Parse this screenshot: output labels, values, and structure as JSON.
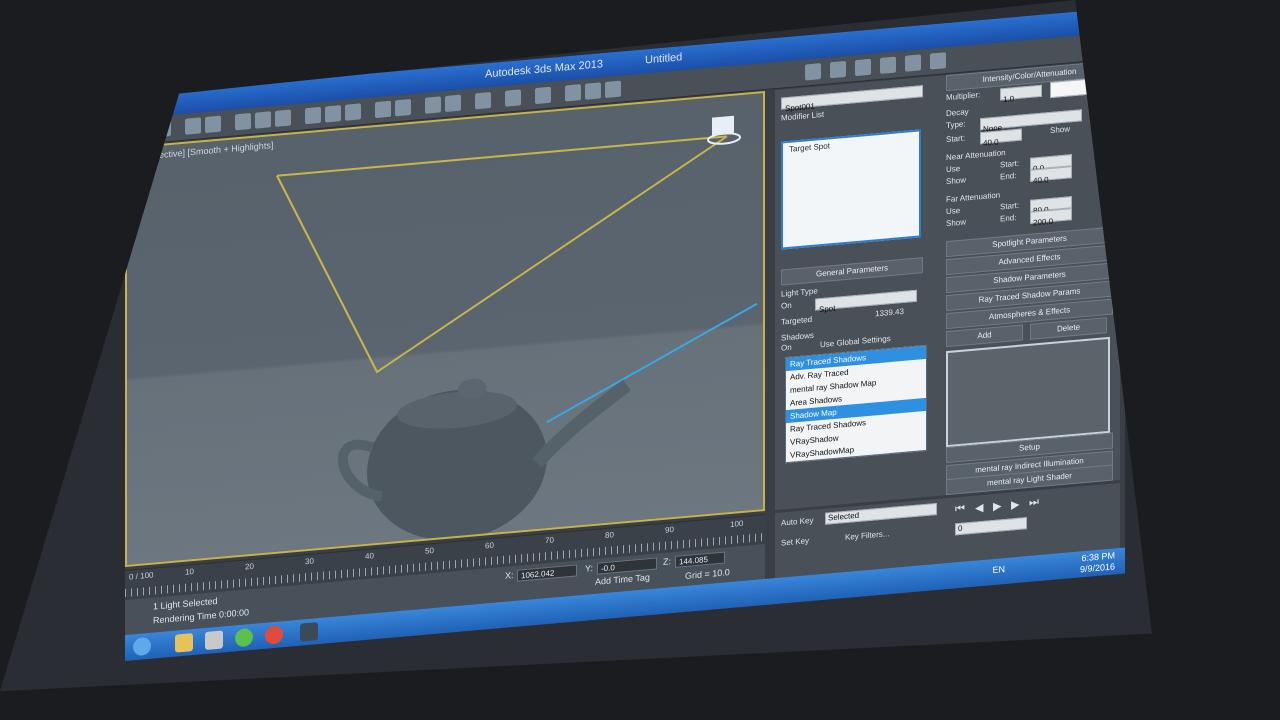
{
  "window": {
    "title": "Autodesk 3ds Max 2013",
    "file": "Untitled"
  },
  "viewport": {
    "label": "[Perspective] [Smooth + Highlights]"
  },
  "command_panel": {
    "object_name": "Spot001",
    "modifier_list": "Modifier List",
    "stack_item": "Target Spot",
    "general_parameters": "General Parameters",
    "light_type_label": "Light Type",
    "on_label": "On",
    "light_type_value": "Spot",
    "targeted_label": "Targeted",
    "targeted_value": "1339.43",
    "shadows_label": "Shadows",
    "shadows_on_label": "On",
    "use_global_settings": "Use Global Settings",
    "shadow_type_current": "Ray Traced Shadows",
    "shadow_options": [
      "Adv. Ray Traced",
      "mental ray Shadow Map",
      "Area Shadows",
      "Shadow Map",
      "Ray Traced Shadows",
      "VRayShadow",
      "VRayShadowMap"
    ],
    "right_rollouts": {
      "intensity": "Intensity/Color/Attenuation",
      "multiplier_label": "Multiplier:",
      "multiplier_value": "1.0",
      "decay_label": "Decay",
      "type_label": "Type:",
      "type_value": "None",
      "start_label": "Start:",
      "start_value": "40.0",
      "show_label": "Show",
      "near_attenuation": "Near Attenuation",
      "use_label": "Use",
      "near_start": "0.0",
      "near_end": "40.0",
      "end_label": "End:",
      "far_attenuation": "Far Attenuation",
      "far_start": "80.0",
      "far_end": "200.0",
      "spotlight_parameters": "Spotlight Parameters",
      "advanced_effects": "Advanced Effects",
      "shadow_parameters": "Shadow Parameters",
      "ray_traced_shadow_params": "Ray Traced Shadow Params",
      "atmospheres_effects": "Atmospheres & Effects",
      "add": "Add",
      "delete": "Delete",
      "setup": "Setup",
      "mr_indirect": "mental ray Indirect Illumination",
      "mr_light_shader": "mental ray Light Shader"
    }
  },
  "timeline": {
    "frame_counter": "0 / 100",
    "ticks": [
      "10",
      "20",
      "30",
      "40",
      "50",
      "60",
      "70",
      "80",
      "90",
      "100"
    ]
  },
  "status": {
    "selection": "1 Light Selected",
    "render_time": "Rendering Time 0:00:00",
    "x_label": "X:",
    "x": "1062.042",
    "y_label": "Y:",
    "y": "-0.0",
    "z_label": "Z:",
    "z": "144.085",
    "grid": "Grid = 10.0",
    "add_time_tag": "Add Time Tag"
  },
  "animation": {
    "auto_key": "Auto Key",
    "set_key": "Set Key",
    "selected": "Selected",
    "key_filters": "Key Filters...",
    "frame": "0"
  },
  "taskbar": {
    "language": "EN",
    "time": "6:38 PM",
    "date": "9/9/2016"
  }
}
